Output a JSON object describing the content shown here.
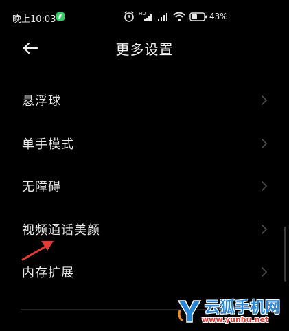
{
  "status_bar": {
    "time": "晚上10:03",
    "battery_percent": "43%"
  },
  "header": {
    "title": "更多设置"
  },
  "settings_items": [
    {
      "label": "悬浮球"
    },
    {
      "label": "单手模式"
    },
    {
      "label": "无障碍"
    },
    {
      "label": "视频通话美颜"
    },
    {
      "label": "内存扩展"
    }
  ],
  "watermark": {
    "brand": "云狐手机网",
    "url": "www.yunhu.net"
  },
  "colors": {
    "background": "#000000",
    "text": "#e9e9e9",
    "chevron": "#4a4a4a",
    "annotation_arrow": "#e53935",
    "watermark_blue": "#2a86d8",
    "watermark_red": "#e53935"
  },
  "icons": [
    "back-arrow-icon",
    "chevron-right-icon",
    "alarm-icon",
    "hd-icon",
    "signal-icon",
    "wifi-icon",
    "battery-icon"
  ]
}
